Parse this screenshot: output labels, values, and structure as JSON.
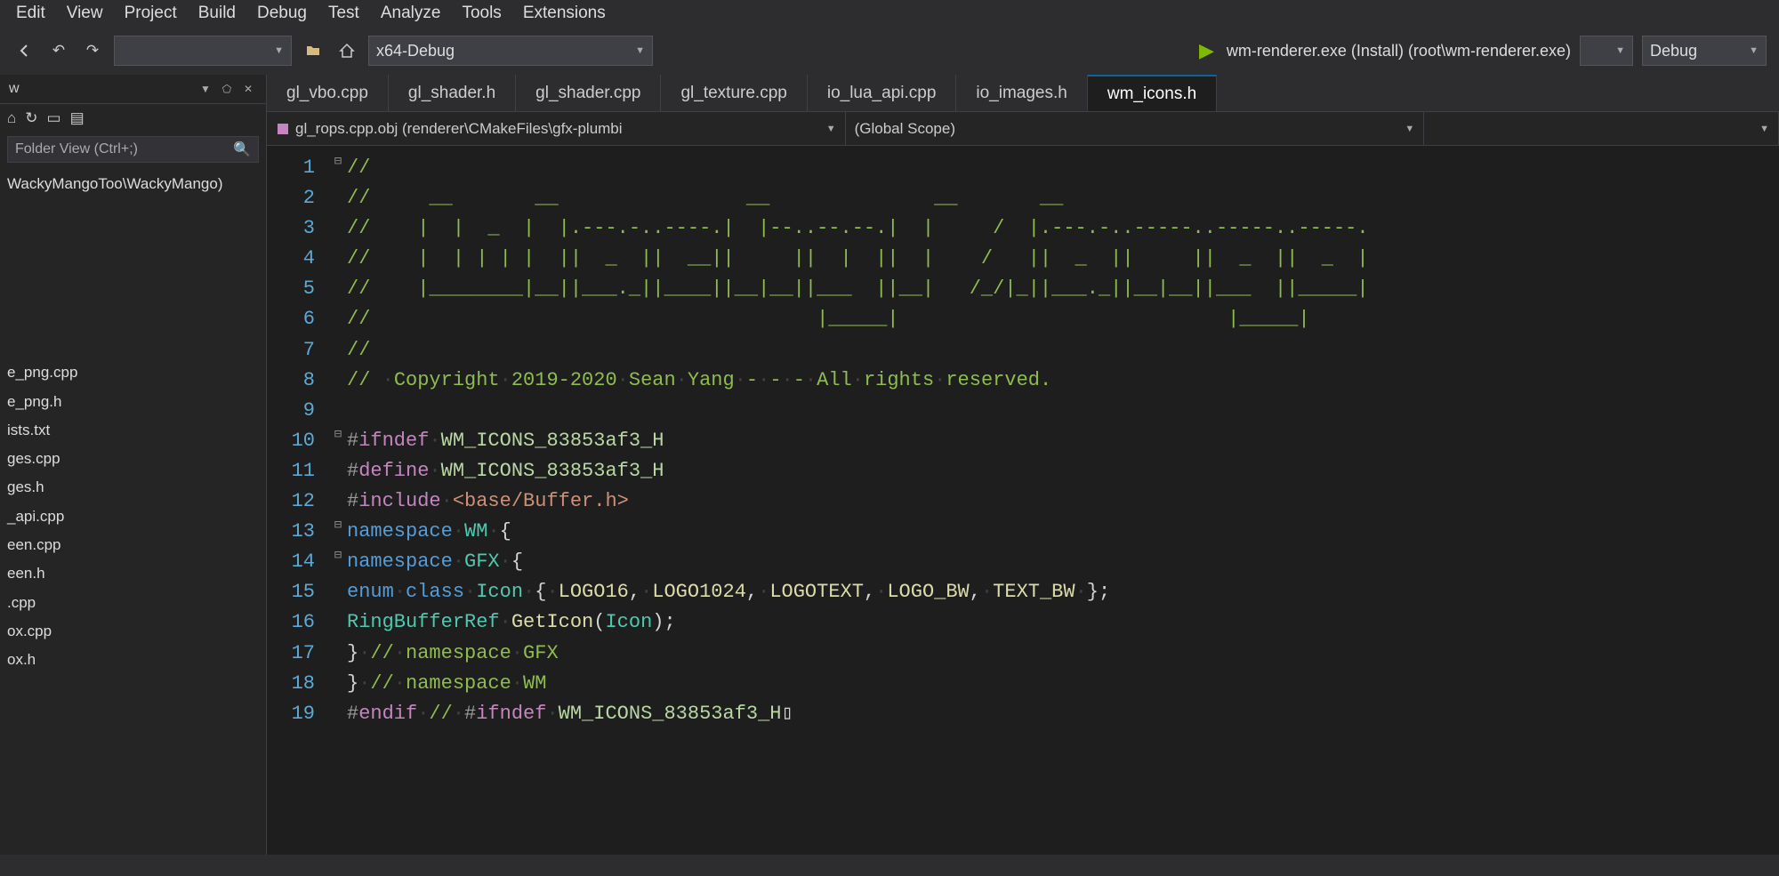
{
  "menu": {
    "items": [
      "Edit",
      "View",
      "Project",
      "Build",
      "Debug",
      "Test",
      "Analyze",
      "Tools",
      "Extensions"
    ]
  },
  "toolbar": {
    "config_combo": "x64-Debug",
    "run_label": "wm-renderer.exe (Install) (root\\wm-renderer.exe)",
    "debug_combo": "Debug"
  },
  "sidepane": {
    "title_short": "w",
    "search_placeholder": "Folder View (Ctrl+;)",
    "root": "WackyMangoToo\\WackyMango)",
    "files": [
      "e_png.cpp",
      "e_png.h",
      "ists.txt",
      "ges.cpp",
      "ges.h",
      "_api.cpp",
      "een.cpp",
      "een.h",
      ".cpp",
      "ox.cpp",
      "ox.h"
    ]
  },
  "tabs": [
    {
      "label": "gl_vbo.cpp",
      "active": false
    },
    {
      "label": "gl_shader.h",
      "active": false
    },
    {
      "label": "gl_shader.cpp",
      "active": false
    },
    {
      "label": "gl_texture.cpp",
      "active": false
    },
    {
      "label": "io_lua_api.cpp",
      "active": false
    },
    {
      "label": "io_images.h",
      "active": false
    },
    {
      "label": "wm_icons.h",
      "active": true
    }
  ],
  "navbar": {
    "left": "gl_rops.cpp.obj (renderer\\CMakeFiles\\gfx-plumbi",
    "right": "(Global Scope)"
  },
  "code": {
    "ascii_banner_label": "WackyMango",
    "lines": [
      {
        "n": 1,
        "fold": "⊟",
        "tokens": [
          [
            "c-comment",
            "//"
          ]
        ]
      },
      {
        "n": 2,
        "tokens": [
          [
            "c-comment",
            "// "
          ],
          [
            "c-comment",
            "    __       __                __              __       __"
          ]
        ]
      },
      {
        "n": 3,
        "tokens": [
          [
            "c-comment",
            "// "
          ],
          [
            "c-comment",
            "   |  |  _  |  |.---.-..----.|  |--..--.--.|  |     /  |.---.-..-----..-----..-----."
          ]
        ]
      },
      {
        "n": 4,
        "tokens": [
          [
            "c-comment",
            "// "
          ],
          [
            "c-comment",
            "   |  | | | |  ||  _  ||  __||     ||  |  ||  |    /   ||  _  ||     ||  _  ||  _  |"
          ]
        ]
      },
      {
        "n": 5,
        "tokens": [
          [
            "c-comment",
            "// "
          ],
          [
            "c-comment",
            "   |________|__||___._||____||__|__||___  ||__|   /_/|_||___._||__|__||___  ||_____|"
          ]
        ]
      },
      {
        "n": 6,
        "tokens": [
          [
            "c-comment",
            "// "
          ],
          [
            "c-comment",
            "                                     |_____|                            |_____|"
          ]
        ]
      },
      {
        "n": 7,
        "tokens": [
          [
            "c-comment",
            "// "
          ]
        ]
      },
      {
        "n": 8,
        "tokens": [
          [
            "c-comment",
            "// "
          ],
          [
            "c-dot",
            "·"
          ],
          [
            "c-comment",
            "Copyright"
          ],
          [
            "c-dot",
            "·"
          ],
          [
            "c-comment",
            "2019-2020"
          ],
          [
            "c-dot",
            "·"
          ],
          [
            "c-comment",
            "Sean"
          ],
          [
            "c-dot",
            "·"
          ],
          [
            "c-comment",
            "Yang"
          ],
          [
            "c-dot",
            "·"
          ],
          [
            "c-comment",
            "-"
          ],
          [
            "c-dot",
            "·"
          ],
          [
            "c-comment",
            "-"
          ],
          [
            "c-dot",
            "·"
          ],
          [
            "c-comment",
            "-"
          ],
          [
            "c-dot",
            "·"
          ],
          [
            "c-comment",
            "All"
          ],
          [
            "c-dot",
            "·"
          ],
          [
            "c-comment",
            "rights"
          ],
          [
            "c-dot",
            "·"
          ],
          [
            "c-comment",
            "reserved."
          ]
        ]
      },
      {
        "n": 9,
        "tokens": []
      },
      {
        "n": 10,
        "fold": "⊟",
        "tokens": [
          [
            "c-pre",
            "#"
          ],
          [
            "c-premacro",
            "ifndef"
          ],
          [
            "c-dot",
            "·"
          ],
          [
            "c-macro",
            "WM_ICONS_83853af3_H"
          ]
        ]
      },
      {
        "n": 11,
        "tokens": [
          [
            "c-pre",
            "#"
          ],
          [
            "c-premacro",
            "define"
          ],
          [
            "c-dot",
            "·"
          ],
          [
            "c-macro",
            "WM_ICONS_83853af3_H"
          ]
        ]
      },
      {
        "n": 12,
        "tokens": [
          [
            "c-pre",
            "#"
          ],
          [
            "c-premacro",
            "include"
          ],
          [
            "c-dot",
            "·"
          ],
          [
            "c-str",
            "<base/Buffer.h>"
          ]
        ]
      },
      {
        "n": 13,
        "fold": "⊟",
        "tokens": [
          [
            "c-key",
            "namespace"
          ],
          [
            "c-dot",
            "·"
          ],
          [
            "c-type",
            "WM"
          ],
          [
            "c-dot",
            "·"
          ],
          [
            "c-text",
            "{"
          ]
        ]
      },
      {
        "n": 14,
        "fold": "⊟",
        "tokens": [
          [
            "c-key",
            "namespace"
          ],
          [
            "c-dot",
            "·"
          ],
          [
            "c-type",
            "GFX"
          ],
          [
            "c-dot",
            "·"
          ],
          [
            "c-text",
            "{"
          ]
        ]
      },
      {
        "n": 15,
        "tokens": [
          [
            "c-key",
            "enum"
          ],
          [
            "c-dot",
            "·"
          ],
          [
            "c-key",
            "class"
          ],
          [
            "c-dot",
            "·"
          ],
          [
            "c-type",
            "Icon"
          ],
          [
            "c-dot",
            "·"
          ],
          [
            "c-text",
            "{"
          ],
          [
            "c-dot",
            "·"
          ],
          [
            "c-id",
            "LOGO16"
          ],
          [
            "c-text",
            ","
          ],
          [
            "c-dot",
            "·"
          ],
          [
            "c-id",
            "LOGO1024"
          ],
          [
            "c-text",
            ","
          ],
          [
            "c-dot",
            "·"
          ],
          [
            "c-id",
            "LOGOTEXT"
          ],
          [
            "c-text",
            ","
          ],
          [
            "c-dot",
            "·"
          ],
          [
            "c-id",
            "LOGO_BW"
          ],
          [
            "c-text",
            ","
          ],
          [
            "c-dot",
            "·"
          ],
          [
            "c-id",
            "TEXT_BW"
          ],
          [
            "c-dot",
            "·"
          ],
          [
            "c-text",
            "};"
          ]
        ]
      },
      {
        "n": 16,
        "tokens": [
          [
            "c-type",
            "RingBufferRef"
          ],
          [
            "c-dot",
            "·"
          ],
          [
            "c-id",
            "GetIcon"
          ],
          [
            "c-text",
            "("
          ],
          [
            "c-type",
            "Icon"
          ],
          [
            "c-text",
            ");"
          ]
        ]
      },
      {
        "n": 17,
        "tokens": [
          [
            "c-text",
            "}"
          ],
          [
            "c-dot",
            "·"
          ],
          [
            "c-comment",
            "//"
          ],
          [
            "c-dot",
            "·"
          ],
          [
            "c-comment",
            "namespace"
          ],
          [
            "c-dot",
            "·"
          ],
          [
            "c-comment",
            "GFX"
          ]
        ]
      },
      {
        "n": 18,
        "tokens": [
          [
            "c-text",
            "}"
          ],
          [
            "c-dot",
            "·"
          ],
          [
            "c-comment",
            "//"
          ],
          [
            "c-dot",
            "·"
          ],
          [
            "c-comment",
            "namespace"
          ],
          [
            "c-dot",
            "·"
          ],
          [
            "c-comment",
            "WM"
          ]
        ]
      },
      {
        "n": 19,
        "tokens": [
          [
            "c-pre",
            "#"
          ],
          [
            "c-premacro",
            "endif"
          ],
          [
            "c-dot",
            "·"
          ],
          [
            "c-comment",
            "//"
          ],
          [
            "c-dot",
            "·"
          ],
          [
            "c-pre",
            "#"
          ],
          [
            "c-premacro",
            "ifndef"
          ],
          [
            "c-dot",
            "·"
          ],
          [
            "c-macro",
            "WM_ICONS_83853af3_H"
          ],
          [
            "c-text",
            "▯"
          ]
        ]
      }
    ]
  }
}
